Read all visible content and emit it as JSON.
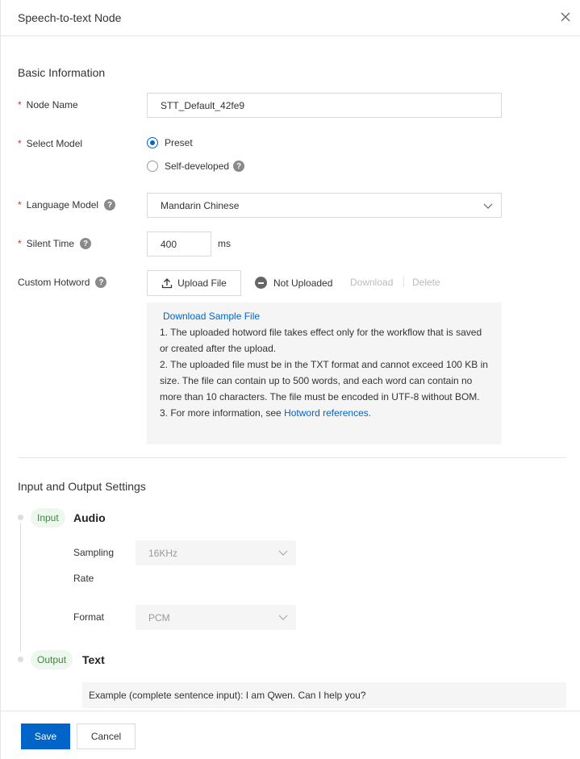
{
  "header": {
    "title": "Speech-to-text Node"
  },
  "basic": {
    "section_title": "Basic Information",
    "node_name": {
      "label": "Node Name",
      "value": "STT_Default_42fe9"
    },
    "select_model": {
      "label": "Select Model",
      "options": [
        "Preset",
        "Self-developed"
      ],
      "selected": "Preset"
    },
    "language_model": {
      "label": "Language Model",
      "value": "Mandarin Chinese"
    },
    "silent_time": {
      "label": "Silent Time",
      "value": "400",
      "unit": "ms"
    },
    "hotword": {
      "label": "Custom Hotword",
      "upload_label": "Upload File",
      "status": "Not Uploaded",
      "download": "Download",
      "delete": "Delete",
      "sample_link": "Download Sample File",
      "line1": "1. The uploaded hotword file takes effect only for the workflow that is saved or created after the upload.",
      "line2": "2. The uploaded file must be in the TXT format and cannot exceed 100 KB in size. The file can contain up to 500 words, and each word can contain no more than 10 characters. The file must be encoded in UTF-8 without BOM.",
      "line3_prefix": "3. For more information, see ",
      "line3_link": "Hotword references."
    }
  },
  "io": {
    "section_title": "Input and Output Settings",
    "input_tag": "Input",
    "input_title": "Audio",
    "sampling_rate_label_1": "Sampling",
    "sampling_rate_label_2": "Rate",
    "sampling_rate_value": "16KHz",
    "format_label": "Format",
    "format_value": "PCM",
    "output_tag": "Output",
    "output_title": "Text",
    "example": "Example (complete sentence input): I am Qwen. Can I help you?"
  },
  "footer": {
    "save": "Save",
    "cancel": "Cancel"
  },
  "colors": {
    "primary": "#0064c8",
    "required": "#d93026",
    "tag_green": "#3c8a3c"
  }
}
